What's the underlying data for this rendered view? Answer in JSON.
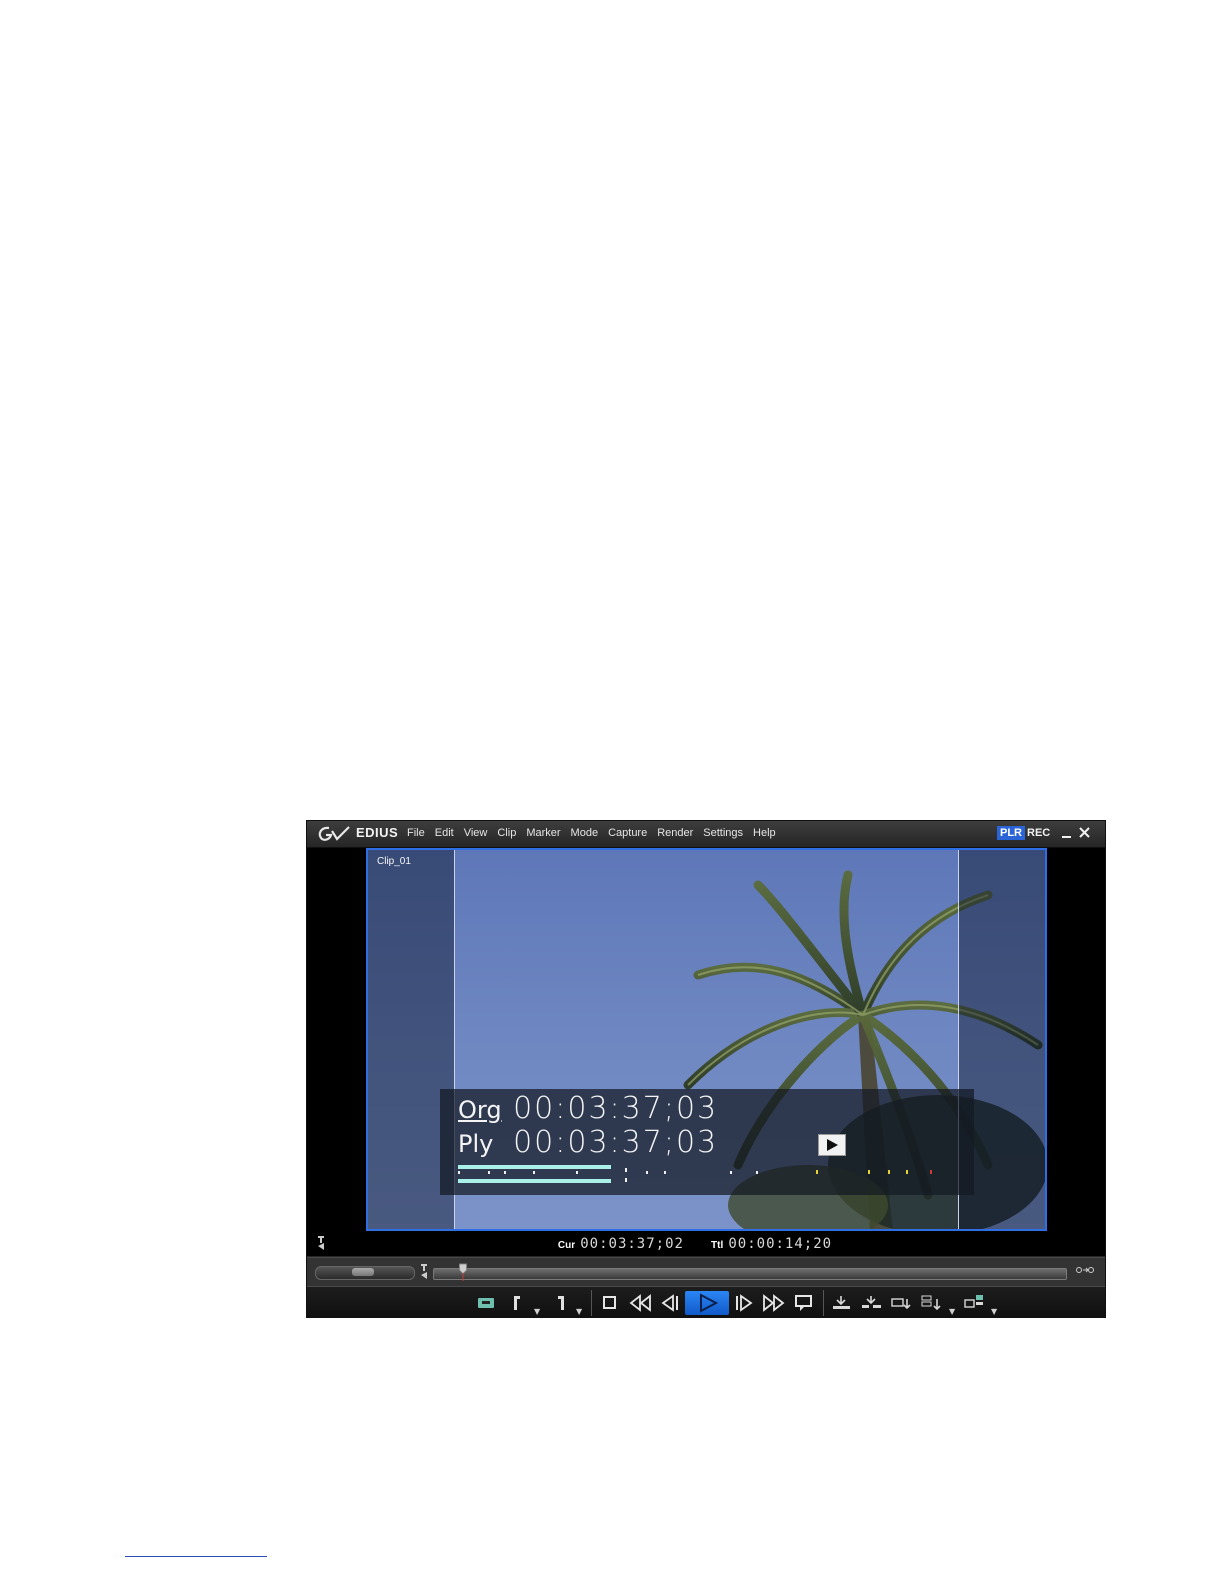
{
  "app": {
    "brand": "EDIUS",
    "menu": [
      "File",
      "Edit",
      "View",
      "Clip",
      "Marker",
      "Mode",
      "Capture",
      "Render",
      "Settings",
      "Help"
    ],
    "mode_player": "PLR",
    "mode_recorder": "REC",
    "minimize_icon": "minimize-icon",
    "close_icon": "close-icon"
  },
  "viewer": {
    "clip_name": "Clip_01",
    "timecode": {
      "org_label": "Org",
      "org_value": "00:03:37;03",
      "ply_label": "Ply",
      "ply_value": "00:03:37;03"
    },
    "cur_label": "Cur",
    "cur_value": "00:03:37;02",
    "ttl_label": "Ttl",
    "ttl_value": "00:00:14;20"
  },
  "transport": {
    "buttons": [
      "set-in-icon",
      "set-out-icon",
      "stop-icon",
      "rewind-icon",
      "step-back-icon",
      "play-icon",
      "step-forward-icon",
      "fast-forward-icon",
      "loop-icon",
      "insert-icon",
      "overwrite-icon",
      "add-to-bin-icon",
      "export-icon",
      "layout-icon"
    ]
  },
  "colors": {
    "accent": "#2a64d6",
    "frame_border": "#2f6fe6",
    "play_button": "#1f73e0"
  }
}
